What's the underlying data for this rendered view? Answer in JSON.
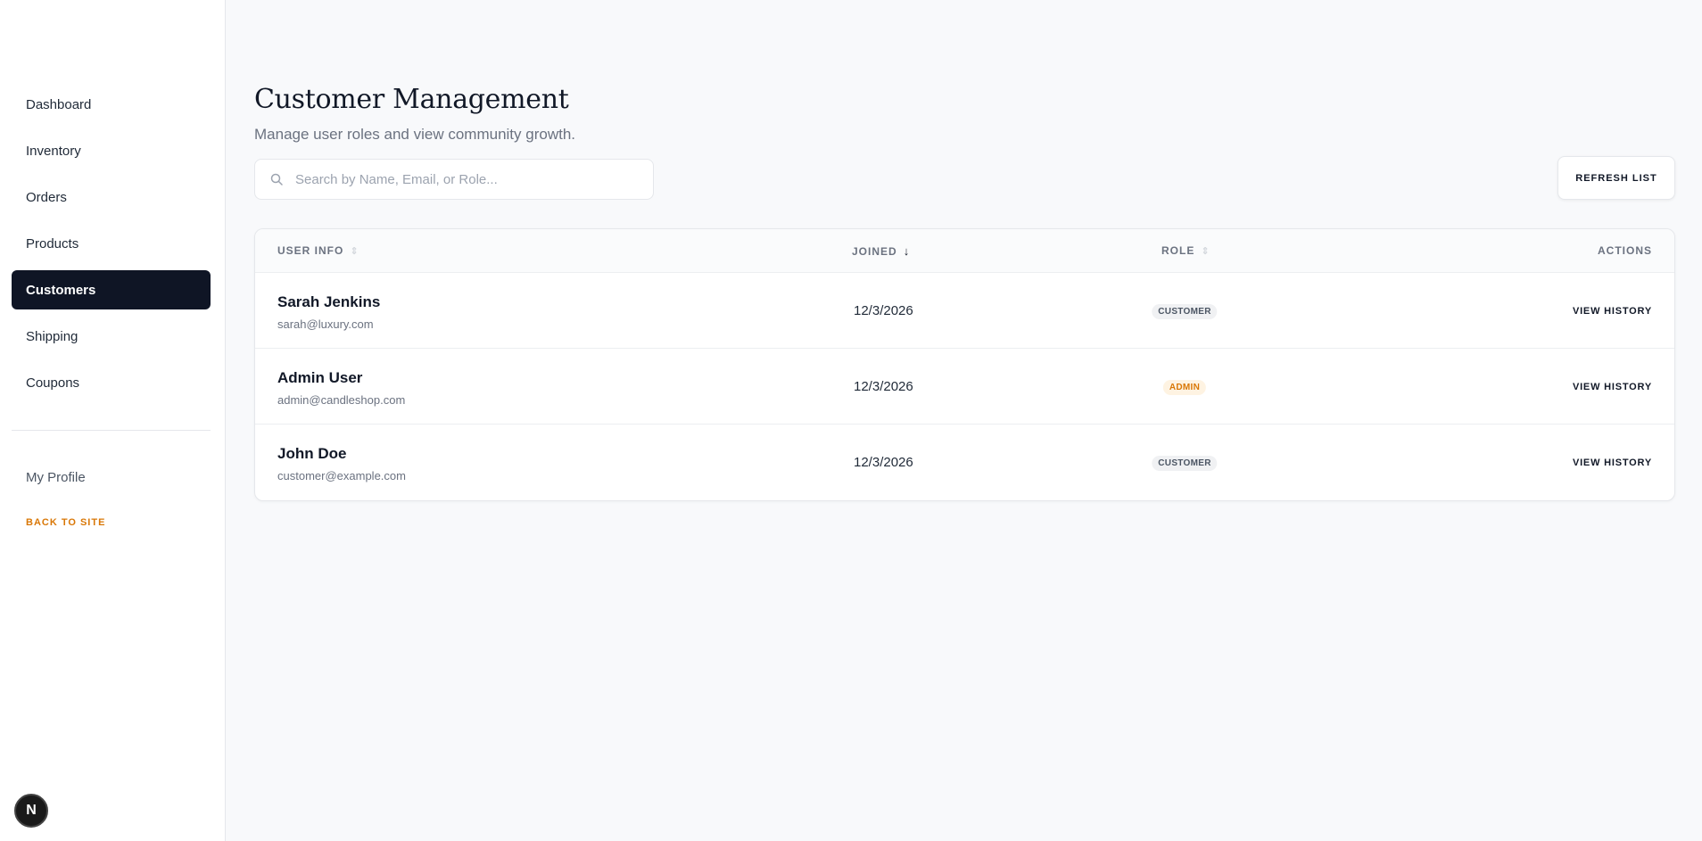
{
  "sidebar": {
    "items": [
      {
        "label": "Dashboard",
        "active": false
      },
      {
        "label": "Inventory",
        "active": false
      },
      {
        "label": "Orders",
        "active": false
      },
      {
        "label": "Products",
        "active": false
      },
      {
        "label": "Customers",
        "active": true
      },
      {
        "label": "Shipping",
        "active": false
      },
      {
        "label": "Coupons",
        "active": false
      }
    ],
    "profile_label": "My Profile",
    "back_label": "BACK TO SITE",
    "badge_letter": "N"
  },
  "header": {
    "title": "Customer Management",
    "subtitle": "Manage user roles and view community growth."
  },
  "search": {
    "placeholder": "Search by Name, Email, or Role...",
    "value": ""
  },
  "toolbar": {
    "refresh_label": "REFRESH LIST"
  },
  "table": {
    "columns": {
      "user_info": "USER INFO",
      "joined": "JOINED",
      "role": "ROLE",
      "actions": "ACTIONS"
    },
    "sort": {
      "column": "joined",
      "direction": "desc"
    },
    "rows": [
      {
        "name": "Sarah Jenkins",
        "email": "sarah@luxury.com",
        "joined": "12/3/2026",
        "role": "CUSTOMER",
        "action": "VIEW HISTORY"
      },
      {
        "name": "Admin User",
        "email": "admin@candleshop.com",
        "joined": "12/3/2026",
        "role": "ADMIN",
        "action": "VIEW HISTORY"
      },
      {
        "name": "John Doe",
        "email": "customer@example.com",
        "joined": "12/3/2026",
        "role": "CUSTOMER",
        "action": "VIEW HISTORY"
      }
    ]
  },
  "colors": {
    "sidebar_active_bg": "#0f1525",
    "accent": "#d97706",
    "page_bg": "#f8f9fb"
  },
  "icons": {
    "search": "search-icon",
    "sort_neutral": "sort-icon",
    "sort_desc": "arrow-down-icon"
  }
}
